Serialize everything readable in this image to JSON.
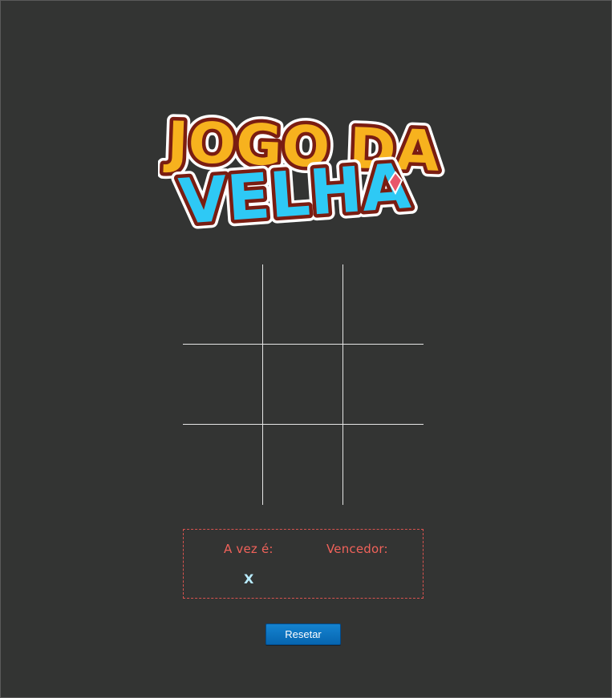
{
  "logo": {
    "line1": "JOGO DA",
    "line2": "VELHA",
    "colors": {
      "line1_fill": "#f7b21e",
      "line1_stroke": "#7a1d12",
      "line2_fill": "#2ec9f5",
      "line2_stroke": "#7a1d12",
      "outline": "#ffffff",
      "gem": "#e8566a"
    }
  },
  "board": {
    "cells": [
      "",
      "",
      "",
      "",
      "",
      "",
      "",
      "",
      ""
    ]
  },
  "status": {
    "turn_label": "A vez é:",
    "turn_value": "X",
    "winner_label": "Vencedor:",
    "winner_value": ""
  },
  "controls": {
    "reset_label": "Resetar"
  },
  "colors": {
    "background": "#333433",
    "grid_lines": "#e6e6e6",
    "label_red": "#f0625a",
    "value_cyan": "#b9ecff",
    "button_blue": "#0a72be"
  }
}
